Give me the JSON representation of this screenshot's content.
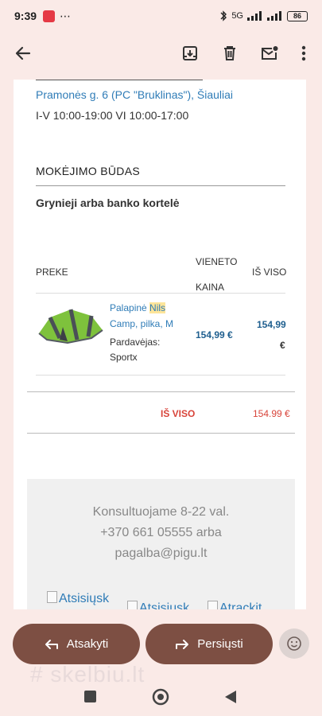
{
  "status_bar": {
    "time": "9:39",
    "more_dots": "⋯",
    "network": "5G",
    "battery": "86"
  },
  "toolbar": {
    "back_label": "Back",
    "archive_label": "Archive",
    "delete_label": "Delete",
    "mark_unread_label": "Mark unread",
    "more_label": "More"
  },
  "email": {
    "pickup": {
      "address": "Pramonės g. 6 (PC \"Bruklinas\"), Šiauliai",
      "hours": "I-V 10:00-19:00 VI 10:00-17:00"
    },
    "payment": {
      "title": "MOKĖJIMO BŪDAS",
      "method": "Grynieji arba banko kortelė"
    },
    "table": {
      "headers": {
        "product": "PREKE",
        "unit_price_line1": "VIENETO",
        "unit_price_line2": "KAINA",
        "total": "IŠ VISO"
      },
      "item": {
        "name_prefix": "Palapinė ",
        "name_highlight": "Nils",
        "name_suffix": "Camp, pilka, M",
        "seller_label": "Pardavėjas:",
        "seller_name": "Sportx",
        "unit_price": "154,99 €",
        "total_number": "154,99",
        "total_currency": "€"
      },
      "grand_total_label": "IŠ VISO",
      "grand_total_value": "154.99 €"
    },
    "footer": {
      "line1": "Konsultuojame 8-22 val.",
      "line2": "+370 661 05555 arba",
      "line3": "pagalba@pigu.lt",
      "img1_alt": "Atsisiųsk",
      "img2_alt": "Atsisiųsk",
      "img3_alt": "Atrackit"
    }
  },
  "actions": {
    "reply_label": "Atsakyti",
    "forward_label": "Persiųsti"
  },
  "watermark": "# skelbiu.lt",
  "colors": {
    "accent_button": "#7d4f43",
    "link": "#2f7cb7",
    "total_red": "#d8443a",
    "app_background": "#faeae7"
  }
}
